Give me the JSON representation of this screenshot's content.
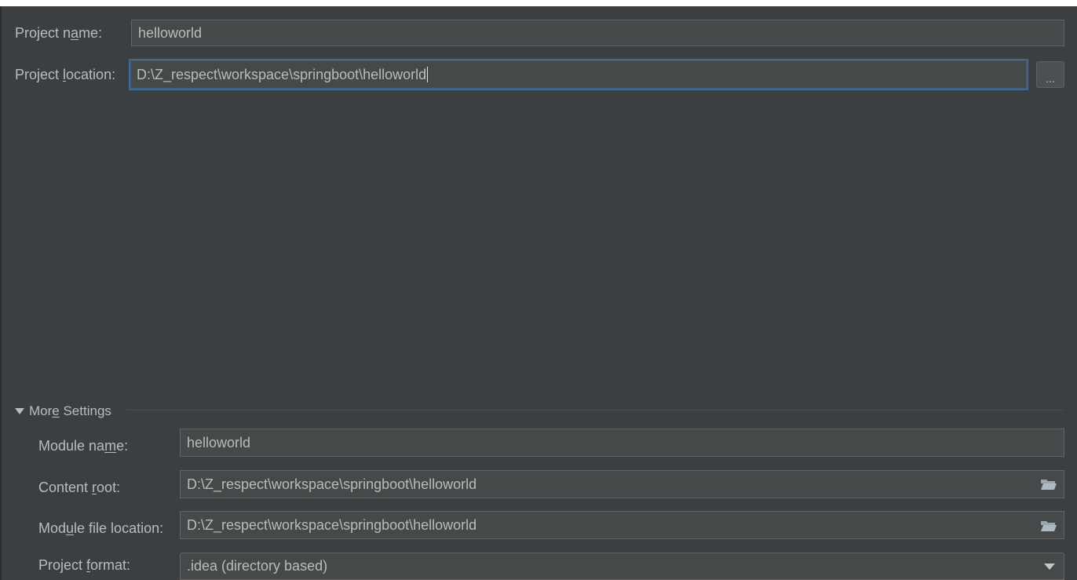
{
  "project": {
    "name_label_pre": "Project n",
    "name_label_mn": "a",
    "name_label_post": "me:",
    "name_value": "helloworld",
    "location_label_pre": "Project ",
    "location_label_mn": "l",
    "location_label_post": "ocation:",
    "location_value": "D:\\Z_respect\\workspace\\springboot\\helloworld",
    "browse_label": "..."
  },
  "more_settings": {
    "title_pre": "Mor",
    "title_mn": "e",
    "title_post": " Settings",
    "module_name_label_pre": "Module na",
    "module_name_label_mn": "m",
    "module_name_label_post": "e:",
    "module_name_value": "helloworld",
    "content_root_label_pre": "Content ",
    "content_root_label_mn": "r",
    "content_root_label_post": "oot:",
    "content_root_value": "D:\\Z_respect\\workspace\\springboot\\helloworld",
    "module_file_label_pre": "Mod",
    "module_file_label_mn": "u",
    "module_file_label_post": "le file location:",
    "module_file_value": "D:\\Z_respect\\workspace\\springboot\\helloworld",
    "format_label_pre": "Project ",
    "format_label_mn": "f",
    "format_label_post": "ormat:",
    "format_value": ".idea (directory based)"
  },
  "icons": {
    "folder": "folder-open-icon",
    "dropdown": "chevron-down-icon",
    "section_toggle": "triangle-down-icon"
  },
  "colors": {
    "background": "#3c3f41",
    "field": "#45494a",
    "focus": "#3d6185",
    "text": "#bbbbbb"
  }
}
